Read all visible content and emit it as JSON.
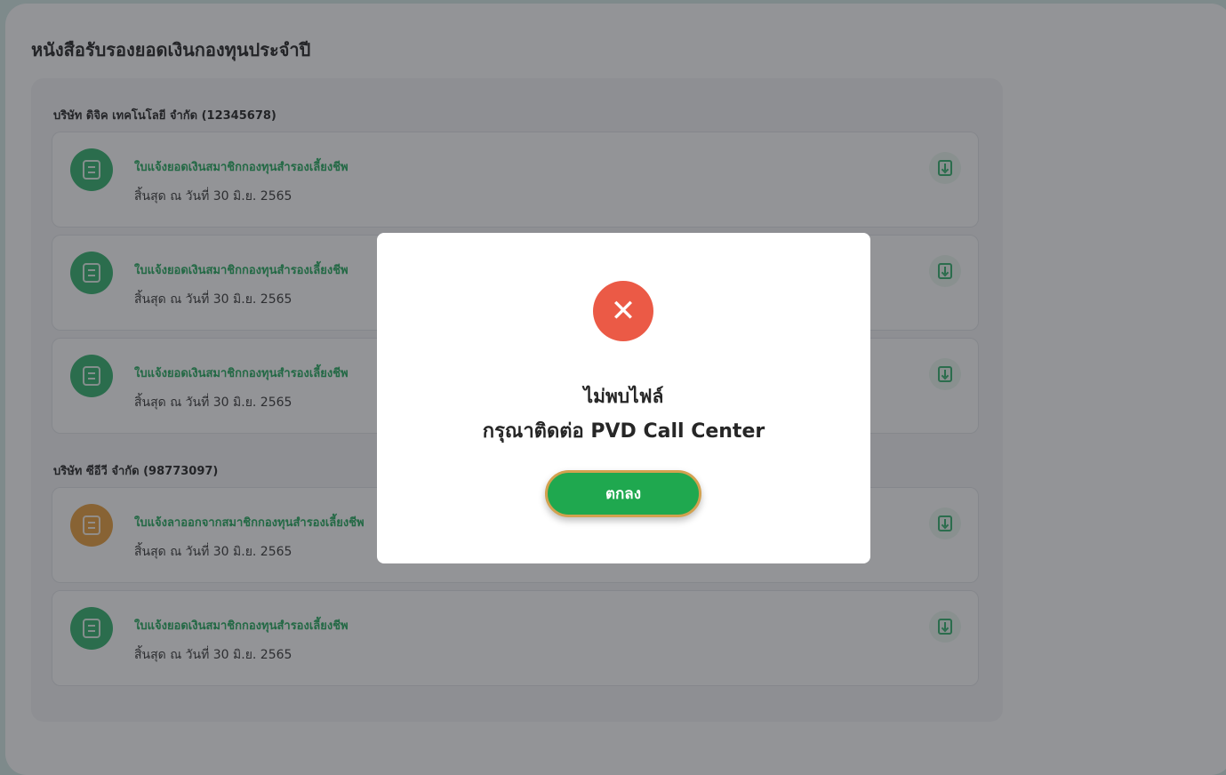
{
  "page": {
    "title": "หนังสือรับรองยอดเงินกองทุนประจำปี"
  },
  "companies": [
    {
      "name": "บริษัท ดิจิค เทคโนโลยี จำกัด  (12345678)",
      "documents": [
        {
          "title": "ใบแจ้งยอดเงินสมาชิกกองทุนสำรองเลี้ยงชีพ",
          "date": "สิ้นสุด ณ วันที่ 30 มิ.ย. 2565",
          "icon": "document-icon",
          "color": "#2fb06a"
        },
        {
          "title": "ใบแจ้งยอดเงินสมาชิกกองทุนสำรองเลี้ยงชีพ",
          "date": "สิ้นสุด ณ วันที่ 30 มิ.ย. 2565",
          "icon": "document-icon",
          "color": "#2fb06a"
        },
        {
          "title": "ใบแจ้งยอดเงินสมาชิกกองทุนสำรองเลี้ยงชีพ",
          "date": "สิ้นสุด ณ วันที่ 30 มิ.ย. 2565",
          "icon": "document-icon",
          "color": "#2fb06a"
        }
      ]
    },
    {
      "name": "บริษัท ซีอีวี จำกัด  (98773097)",
      "documents": [
        {
          "title": "ใบแจ้งลาออกจากสมาชิกกองทุนสำรองเลี้ยงชีพ",
          "date": "สิ้นสุด ณ วันที่ 30 มิ.ย. 2565",
          "icon": "document-icon",
          "color": "#e89d39"
        },
        {
          "title": "ใบแจ้งยอดเงินสมาชิกกองทุนสำรองเลี้ยงชีพ",
          "date": "สิ้นสุด ณ วันที่ 30 มิ.ย. 2565",
          "icon": "document-icon",
          "color": "#2fb06a"
        }
      ]
    }
  ],
  "dialog": {
    "icon": "error-x-icon",
    "icon_color": "#eb5a46",
    "line1": "ไม่พบไฟล์",
    "line2": "กรุณาติดต่อ PVD Call Center",
    "ok_label": "ตกลง",
    "ok_color": "#1fa84f",
    "ok_border_color": "#d3a14f"
  }
}
